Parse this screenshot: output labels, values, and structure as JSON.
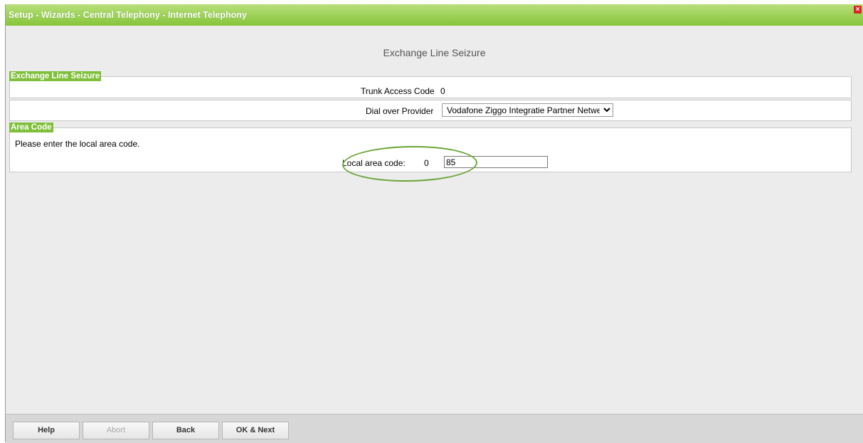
{
  "window": {
    "title": "Setup - Wizards - Central Telephony - Internet Telephony",
    "close_glyph": "×"
  },
  "page": {
    "title": "Exchange Line Seizure"
  },
  "section_exchange": {
    "legend": "Exchange Line Seizure",
    "trunk_label": "Trunk Access Code",
    "trunk_value": "0",
    "provider_label": "Dial over Provider",
    "provider_selected": "Vodafone Ziggo Integratie Partner Netwerk"
  },
  "section_area": {
    "legend": "Area Code",
    "instruction": "Please enter the local area code.",
    "local_label": "Local area code:",
    "prefix": "0",
    "input_value": "85"
  },
  "footer": {
    "help": "Help",
    "abort": "Abort",
    "back": "Back",
    "ok_next": "OK & Next"
  },
  "colors": {
    "title_green": "#86c43a",
    "legend_green": "#7fbf3a",
    "annotation_green": "#6aa535",
    "close_red": "#d8262e"
  }
}
